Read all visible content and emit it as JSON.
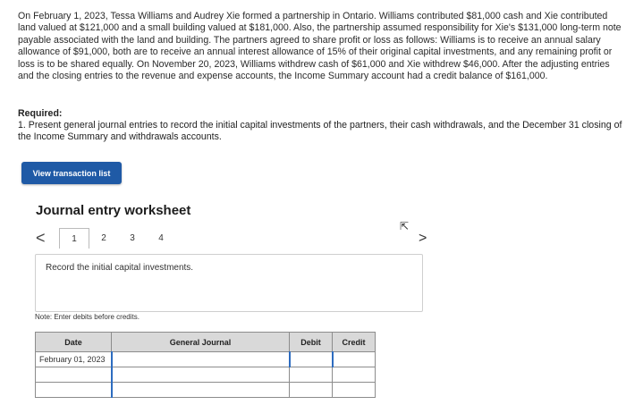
{
  "problem": {
    "text": "On February 1, 2023, Tessa Williams and Audrey Xie formed a partnership in Ontario. Williams contributed $81,000 cash and Xie contributed land valued at $121,000 and a small building valued at $181,000. Also, the partnership assumed responsibility for Xie's $131,000 long-term note payable associated with the land and building. The partners agreed to share profit or loss as follows: Williams is to receive an annual salary allowance of $91,000, both are to receive an annual interest allowance of 15% of their original capital investments, and any remaining profit or loss is to be shared equally. On November 20, 2023, Williams withdrew cash of $61,000 and Xie withdrew $46,000. After the adjusting entries and the closing entries to the revenue and expense accounts, the Income Summary account had a credit balance of $161,000."
  },
  "required": {
    "label": "Required:",
    "text": "1. Present general journal entries to record the initial capital investments of the partners, their cash withdrawals, and the December 31 closing of the Income Summary and withdrawals accounts."
  },
  "view_button": "View transaction list",
  "worksheet": {
    "title": "Journal entry worksheet",
    "pages": [
      "1",
      "2",
      "3",
      "4"
    ],
    "prev": "<",
    "next": ">",
    "instruction": "Record the initial capital investments.",
    "note": "Note: Enter debits before credits.",
    "columns": [
      "Date",
      "General Journal",
      "Debit",
      "Credit"
    ],
    "rows": [
      {
        "date": "February 01, 2023"
      },
      {
        "date": ""
      },
      {
        "date": ""
      }
    ]
  }
}
